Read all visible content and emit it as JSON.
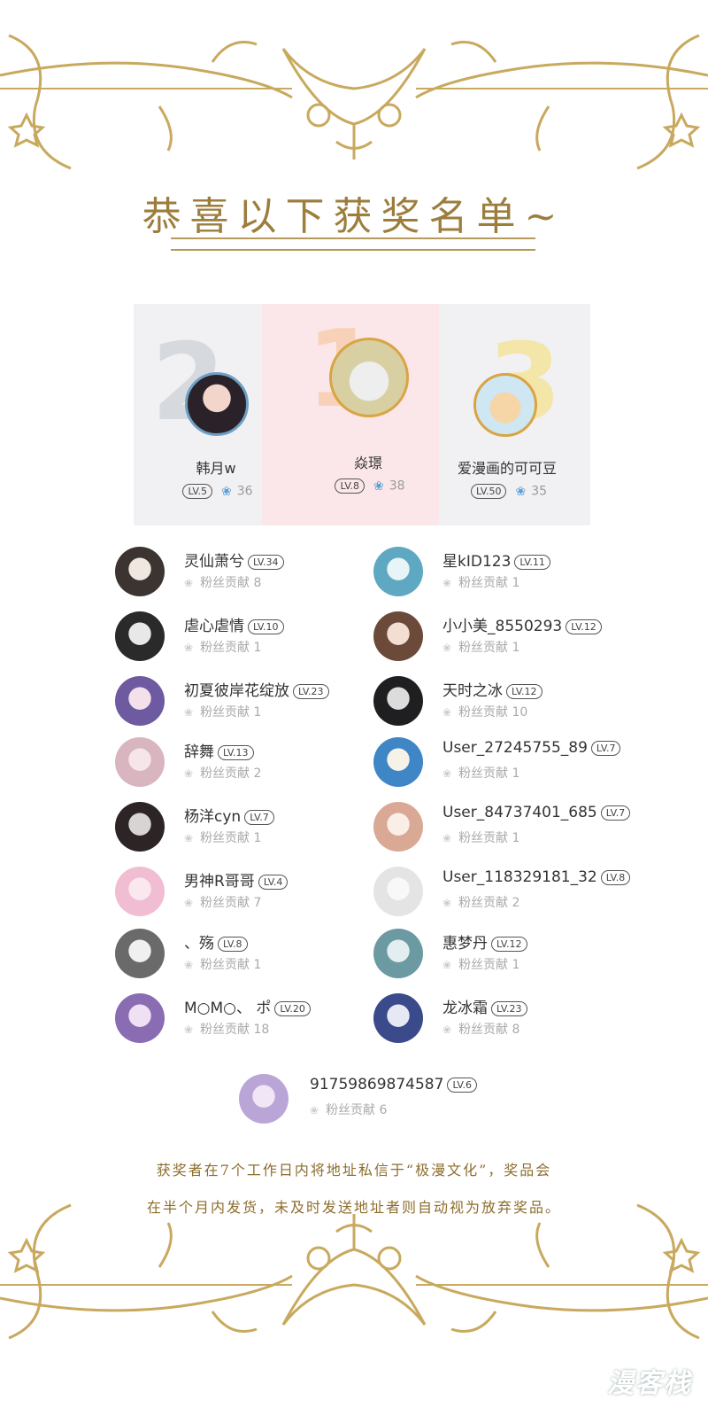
{
  "page": {
    "title": "恭喜以下获奖名单~",
    "notice_line1": "获奖者在7个工作日内将地址私信于“极漫文化”，奖品会",
    "notice_line2": "在半个月内发货，未及时发送地址者则自动视为放弃奖品。",
    "watermark": "漫客栈",
    "accent_color": "#b69a5c"
  },
  "podium": [
    {
      "rank": "2",
      "name": "韩月w",
      "level": "LV.5",
      "score": "36"
    },
    {
      "rank": "1",
      "name": "焱璟",
      "level": "LV.8",
      "score": "38"
    },
    {
      "rank": "3",
      "name": "爱漫画的可可豆",
      "level": "LV.50",
      "score": "35"
    }
  ],
  "winners_left": [
    {
      "name": "灵仙萧兮",
      "level": "LV.34",
      "contrib": "粉丝贡献 8"
    },
    {
      "name": "虐心虐情",
      "level": "LV.10",
      "contrib": "粉丝贡献 1"
    },
    {
      "name": "初夏彼岸花绽放",
      "level": "LV.23",
      "contrib": "粉丝贡献 1"
    },
    {
      "name": "辞舞",
      "level": "LV.13",
      "contrib": "粉丝贡献 2"
    },
    {
      "name": "杨洋cyn",
      "level": "LV.7",
      "contrib": "粉丝贡献 1"
    },
    {
      "name": "男神R哥哥",
      "level": "LV.4",
      "contrib": "粉丝贡献 7"
    },
    {
      "name": "、殇",
      "level": "LV.8",
      "contrib": "粉丝贡献 1"
    },
    {
      "name": "M○M○、 ポ",
      "level": "LV.20",
      "contrib": "粉丝贡献 18"
    }
  ],
  "winners_right": [
    {
      "name": "星kID123",
      "level": "LV.11",
      "contrib": "粉丝贡献 1"
    },
    {
      "name": "小小美_8550293",
      "level": "LV.12",
      "contrib": "粉丝贡献 1"
    },
    {
      "name": "天时之冰",
      "level": "LV.12",
      "contrib": "粉丝贡献 10"
    },
    {
      "name": "User_27245755_89",
      "level": "LV.7",
      "contrib": "粉丝贡献 1"
    },
    {
      "name": "User_84737401_685",
      "level": "LV.7",
      "contrib": "粉丝贡献 1"
    },
    {
      "name": "User_118329181_32",
      "level": "LV.8",
      "contrib": "粉丝贡献 2"
    },
    {
      "name": "惠梦丹",
      "level": "LV.12",
      "contrib": "粉丝贡献 1"
    },
    {
      "name": "龙冰霜",
      "level": "LV.23",
      "contrib": "粉丝贡献 8"
    }
  ],
  "winner_center": {
    "name": "91759869874587",
    "level": "LV.6",
    "contrib": "粉丝贡献 6"
  }
}
